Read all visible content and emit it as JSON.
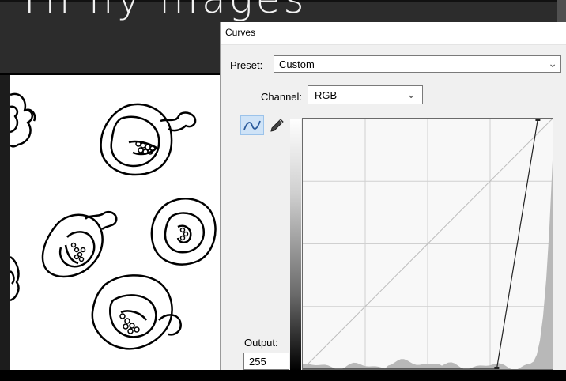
{
  "background": {
    "heading_text": "Th  lly    illages",
    "artwork": "pepper-line-drawings"
  },
  "dialog": {
    "title": "Curves",
    "preset": {
      "label": "Preset:",
      "value": "Custom"
    },
    "channel": {
      "label": "Channel:",
      "value": "RGB"
    },
    "tools": {
      "curve_tool": "curve-icon",
      "pencil_tool": "pencil-icon"
    },
    "output": {
      "label": "Output:",
      "value": "255"
    },
    "curve": {
      "input_range": [
        0,
        255
      ],
      "output_range": [
        0,
        255
      ],
      "control_points": [
        {
          "input": 198,
          "output": 0
        },
        {
          "input": 240,
          "output": 255
        }
      ]
    },
    "colors": {
      "accent": "#cfe3f7",
      "grid": "#d0d0d0",
      "histogram": "#b8b8b8"
    }
  }
}
